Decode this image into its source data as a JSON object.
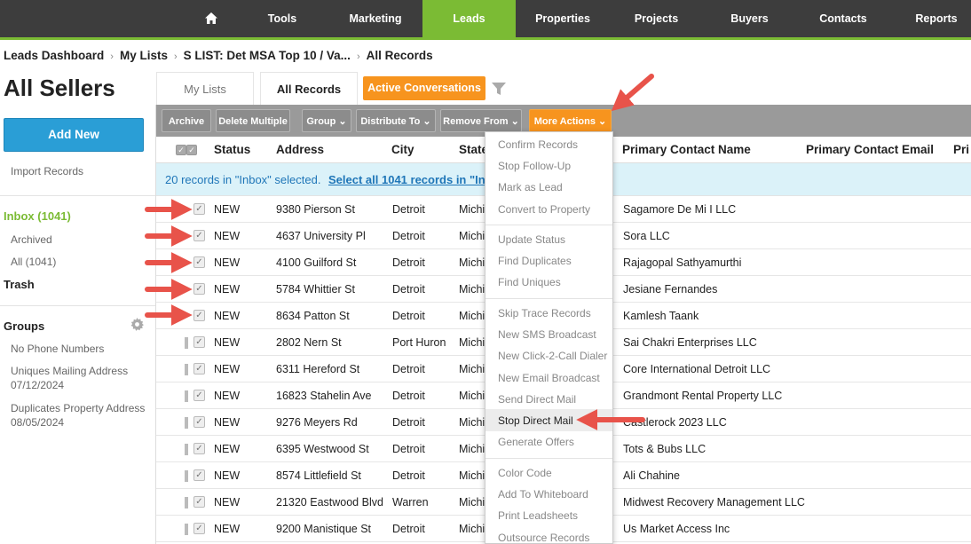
{
  "nav": {
    "home_icon": "home-icon",
    "items": [
      {
        "label": "Tools"
      },
      {
        "label": "Marketing"
      },
      {
        "label": "Leads"
      },
      {
        "label": "Properties"
      },
      {
        "label": "Projects"
      },
      {
        "label": "Buyers"
      },
      {
        "label": "Contacts"
      },
      {
        "label": "Reports"
      }
    ],
    "active_color": "#7bbb34"
  },
  "breadcrumb": [
    "Leads Dashboard",
    "My Lists",
    "S LIST: Det MSA Top 10 / Va...",
    "All Records"
  ],
  "page_title": "All Sellers",
  "tabs": {
    "my_lists": "My Lists",
    "all_records": "All Records",
    "active_conversations": "Active Conversations"
  },
  "sidebar": {
    "add_new": "Add New",
    "import_records": "Import Records",
    "inbox": "Inbox (1041)",
    "archived": "Archived",
    "all": "All (1041)",
    "trash": "Trash",
    "groups": "Groups",
    "group_items": [
      {
        "name": "No Phone Numbers",
        "date": ""
      },
      {
        "name": "Uniques Mailing Address",
        "date": "07/12/2024"
      },
      {
        "name": "Duplicates Property Address",
        "date": "08/05/2024"
      }
    ]
  },
  "toolbar": {
    "archive": "Archive",
    "delete_multiple": "Delete Multiple",
    "group": "Group",
    "distribute_to": "Distribute To",
    "remove_from": "Remove From",
    "more_actions": "More Actions"
  },
  "table": {
    "headers": {
      "status": "Status",
      "address": "Address",
      "city": "City",
      "state": "State",
      "primary_contact_name": "Primary Contact Name",
      "primary_contact_email": "Primary Contact Email",
      "extra": "Pri"
    },
    "selection_text": "20 records in \"Inbox\" selected.",
    "select_all_text": "Select all 1041 records in \"Inb",
    "rows": [
      {
        "status": "NEW",
        "address": "9380 Pierson St",
        "city": "Detroit",
        "state": "Michi",
        "contact": "Sagamore De Mi I LLC"
      },
      {
        "status": "NEW",
        "address": "4637 University Pl",
        "city": "Detroit",
        "state": "Michi",
        "contact": "Sora LLC"
      },
      {
        "status": "NEW",
        "address": "4100 Guilford St",
        "city": "Detroit",
        "state": "Michi",
        "contact": "Rajagopal Sathyamurthi"
      },
      {
        "status": "NEW",
        "address": "5784 Whittier St",
        "city": "Detroit",
        "state": "Michi",
        "contact": "Jesiane Fernandes"
      },
      {
        "status": "NEW",
        "address": "8634 Patton St",
        "city": "Detroit",
        "state": "Michi",
        "contact": "Kamlesh Taank"
      },
      {
        "status": "NEW",
        "address": "2802 Nern St",
        "city": "Port Huron",
        "state": "Michi",
        "contact": "Sai Chakri Enterprises LLC"
      },
      {
        "status": "NEW",
        "address": "6311 Hereford St",
        "city": "Detroit",
        "state": "Michi",
        "contact": "Core International Detroit LLC"
      },
      {
        "status": "NEW",
        "address": "16823 Stahelin Ave",
        "city": "Detroit",
        "state": "Michi",
        "contact": "Grandmont Rental Property LLC"
      },
      {
        "status": "NEW",
        "address": "9276 Meyers Rd",
        "city": "Detroit",
        "state": "Michi",
        "contact": "Castlerock 2023 LLC"
      },
      {
        "status": "NEW",
        "address": "6395 Westwood St",
        "city": "Detroit",
        "state": "Michi",
        "contact": "Tots & Bubs LLC"
      },
      {
        "status": "NEW",
        "address": "8574 Littlefield St",
        "city": "Detroit",
        "state": "Michi",
        "contact": "Ali Chahine"
      },
      {
        "status": "NEW",
        "address": "21320 Eastwood Blvd",
        "city": "Warren",
        "state": "Michi",
        "contact": "Midwest Recovery Management LLC"
      },
      {
        "status": "NEW",
        "address": "9200 Manistique St",
        "city": "Detroit",
        "state": "Michi",
        "contact": "Us Market Access Inc"
      }
    ]
  },
  "dropdown": {
    "groups": [
      [
        "Confirm Records",
        "Stop Follow-Up",
        "Mark as Lead",
        "Convert to Property"
      ],
      [
        "Update Status",
        "Find Duplicates",
        "Find Uniques"
      ],
      [
        "Skip Trace Records",
        "New SMS Broadcast",
        "New Click-2-Call Dialer",
        "New Email Broadcast",
        "Send Direct Mail",
        "Stop Direct Mail",
        "Generate Offers"
      ],
      [
        "Color Code",
        "Add To Whiteboard",
        "Print Leadsheets",
        "Outsource Records"
      ]
    ],
    "highlighted": "Stop Direct Mail"
  },
  "colors": {
    "accent_orange": "#f7941e",
    "link_blue": "#1f76b8",
    "annotation_red": "#e8534a",
    "button_blue": "#2a9ed6"
  }
}
